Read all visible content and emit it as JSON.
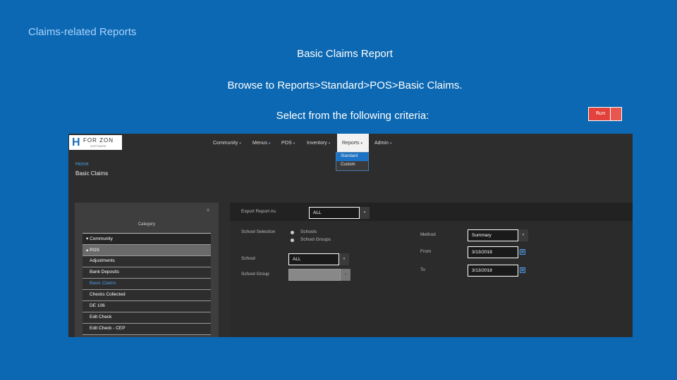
{
  "slide": {
    "title": "Claims-related Reports",
    "report_name": "Basic Claims Report",
    "instruction": "Browse to Reports>Standard>POS>Basic Claims.",
    "criteria": "Select from the following criteria:",
    "run_label": "Run"
  },
  "app": {
    "logo": {
      "mark": "H",
      "text": "FOR ZON",
      "subtext": "SOFTWARE"
    },
    "nav": [
      {
        "label": "Community",
        "caret": "▾"
      },
      {
        "label": "Menus",
        "caret": "▾"
      },
      {
        "label": "POS",
        "caret": "▾"
      },
      {
        "label": "Inventory",
        "caret": "▾"
      },
      {
        "label": "Reports",
        "caret": "▾"
      },
      {
        "label": "Admin",
        "caret": "▾"
      }
    ],
    "reports_dropdown": [
      "Standard",
      "Custom"
    ],
    "breadcrumb": {
      "home": "Home",
      "title": "Basic Claims"
    },
    "left": {
      "plus": "+",
      "category_header": "Category",
      "items": [
        {
          "label": "▾ Community"
        },
        {
          "label": "▴ POS"
        },
        {
          "label": "Adjustments"
        },
        {
          "label": "Bank Deposits"
        },
        {
          "label": "Basic Claims"
        },
        {
          "label": "Checks Collected"
        },
        {
          "label": "DE 106"
        },
        {
          "label": "Edit Check"
        },
        {
          "label": "Edit Check - CEP"
        }
      ]
    },
    "form": {
      "export_label": "Export Report As",
      "export_value": "ALL",
      "school_selection_label": "School Selection",
      "radio_options": [
        "Schools",
        "School Groups"
      ],
      "school_label": "School",
      "school_value": "ALL",
      "school_group_label": "School Group",
      "school_group_value": "",
      "method_label": "Method",
      "method_value": "Summary",
      "from_label": "From",
      "from_value": "3/13/2018",
      "to_label": "To",
      "to_value": "3/13/2018",
      "dropdown_arrow": "▾",
      "calendar_glyph": "▦"
    }
  },
  "colors": {
    "background": "#0c68b2",
    "accent": "#1c72c4",
    "run_button": "#e2423b"
  }
}
